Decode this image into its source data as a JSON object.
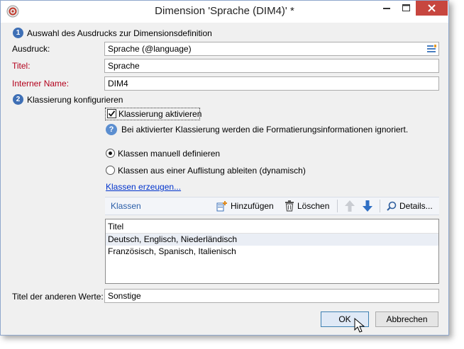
{
  "window": {
    "title": "Dimension 'Sprache (DIM4)' *"
  },
  "section1": {
    "number": "1",
    "heading": "Auswahl des Ausdrucks zur Dimensionsdefinition",
    "expression_label": "Ausdruck:",
    "expression_value": "Sprache (@language)",
    "title_label": "Titel:",
    "title_value": "Sprache",
    "internal_name_label": "Interner Name:",
    "internal_name_value": "DIM4"
  },
  "section2": {
    "number": "2",
    "heading": "Klassierung konfigurieren",
    "enable_label": "Klassierung aktivieren",
    "enable_checked": true,
    "info_text": "Bei aktivierter Klassierung werden die Formatierungsinformationen ignoriert.",
    "radio_manual": "Klassen manuell definieren",
    "radio_dynamic": "Klassen aus einer Auflistung ableiten (dynamisch)",
    "generate_link": "Klassen erzeugen..."
  },
  "classes": {
    "tab_label": "Klassen",
    "add_label": "Hinzufügen",
    "delete_label": "Löschen",
    "details_label": "Details...",
    "column_header": "Titel",
    "rows": [
      "Deutsch, Englisch, Niederländisch",
      "Französisch, Spanisch, Italienisch"
    ]
  },
  "other_values": {
    "label": "Titel der anderen Werte:",
    "value": "Sonstige"
  },
  "buttons": {
    "ok": "OK",
    "cancel": "Abbrechen"
  },
  "colors": {
    "accent": "#3e6fb5",
    "required_label": "#b3001b",
    "link": "#0033cc",
    "close_button": "#c7463f"
  }
}
